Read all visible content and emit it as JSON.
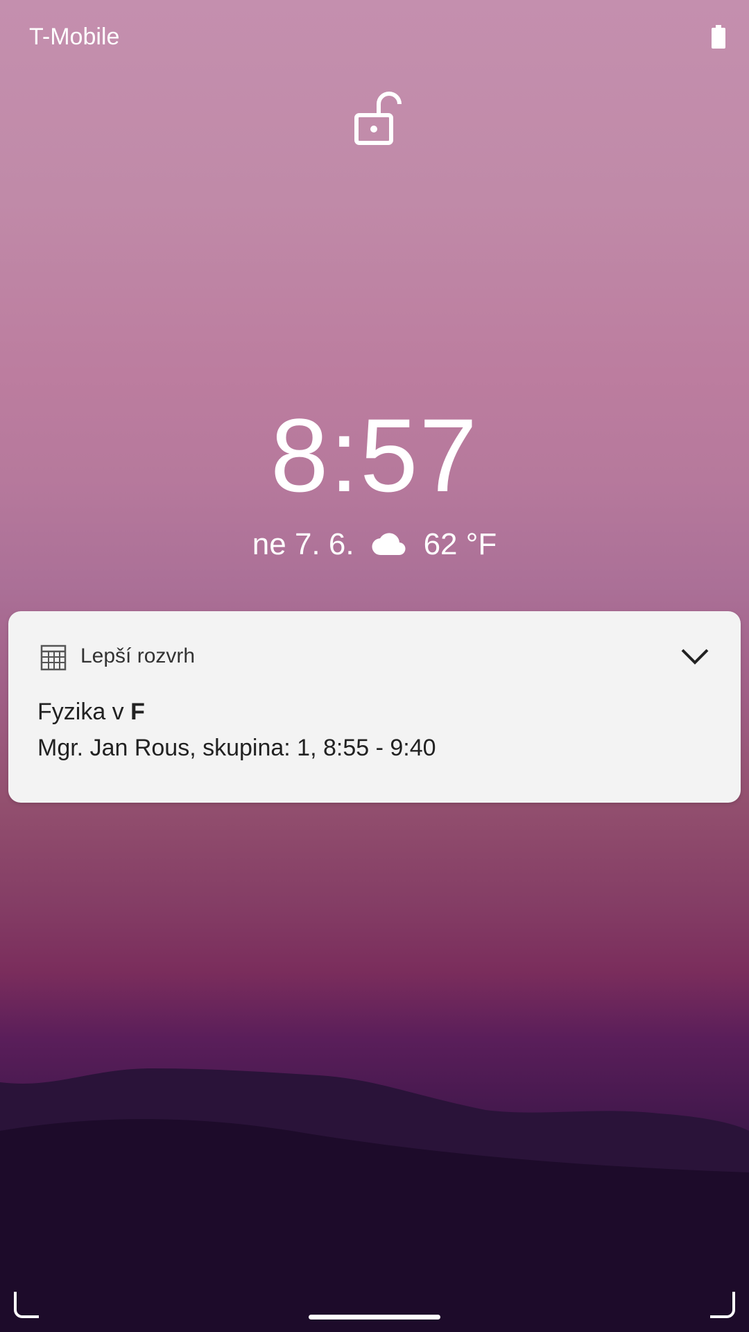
{
  "status_bar": {
    "carrier": "T-Mobile",
    "battery_icon": "battery-full-icon"
  },
  "lock_icon": "lock-open-icon",
  "clock": {
    "time": "8:57",
    "date": "ne 7. 6.",
    "weather_icon": "cloud-icon",
    "temperature": "62 °F"
  },
  "notification": {
    "app_icon": "calendar-grid-icon",
    "app_name": "Lepší rozvrh",
    "expand_icon": "chevron-down-icon",
    "title_prefix": "Fyzika v ",
    "title_bold": "F",
    "text": "Mgr. Jan Rous, skupina: 1, 8:55 - 9:40"
  },
  "navigation": {
    "home_indicator": "home-indicator"
  },
  "colors": {
    "notification_bg": "#f3f3f3",
    "text_white": "#ffffff"
  }
}
